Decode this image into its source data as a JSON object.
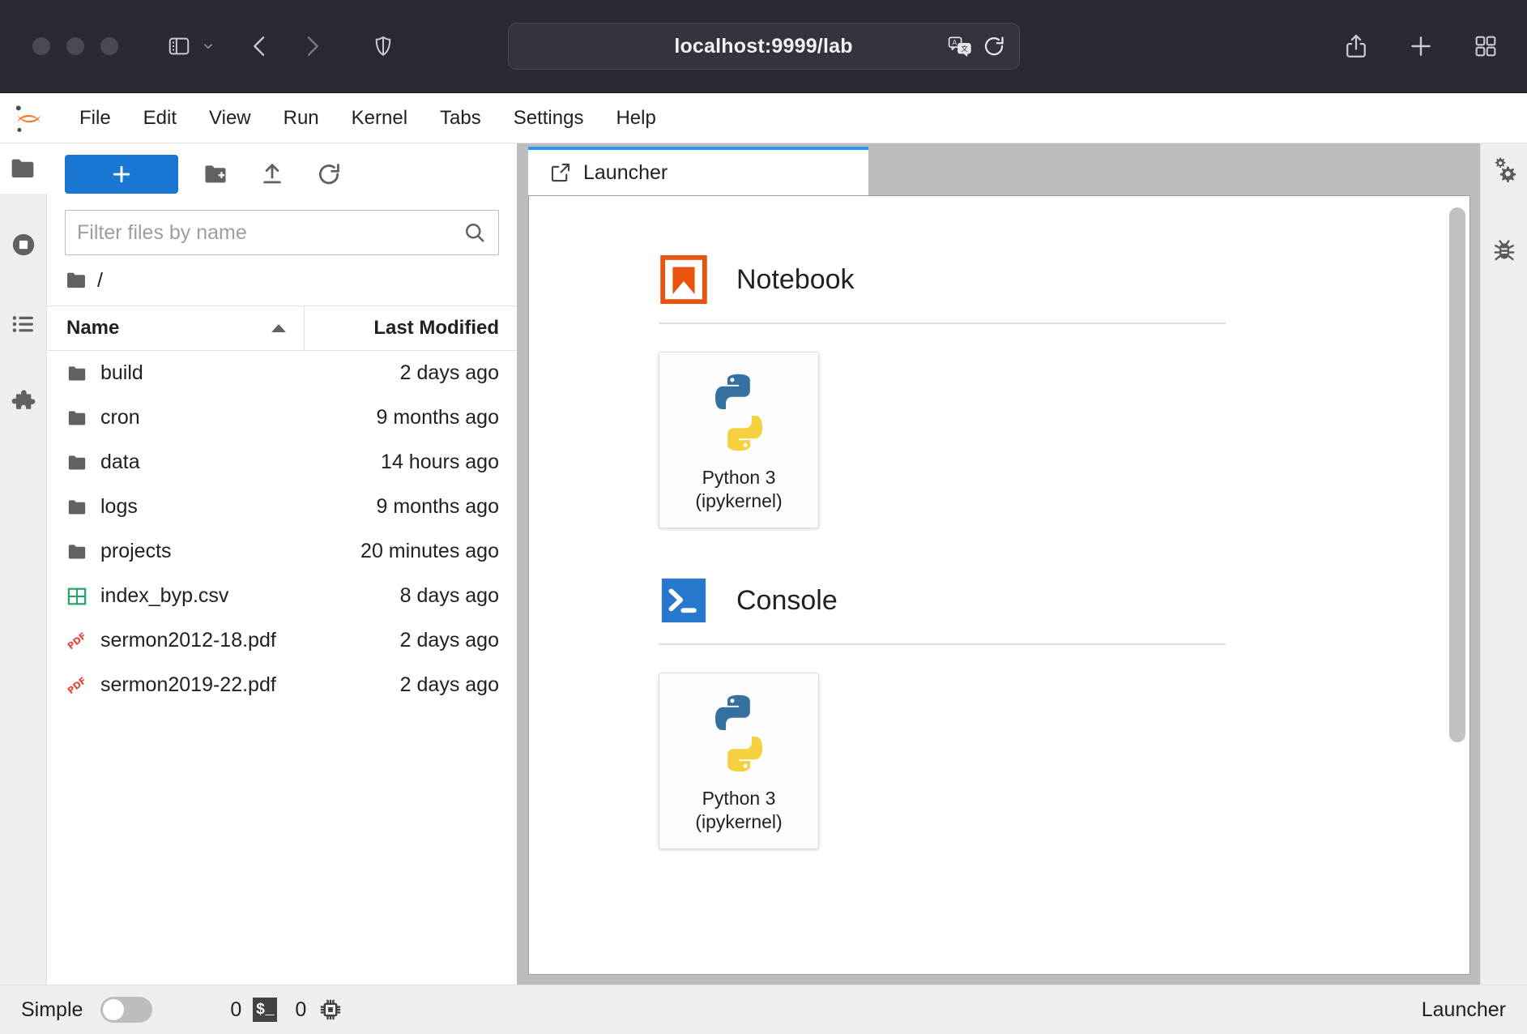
{
  "browser": {
    "url": "localhost:9999/lab",
    "icons": {
      "sidebar_toggle": "sidebar-toggle-icon",
      "sidebar_dropdown": "chevron-down-icon",
      "back": "back-arrow-icon",
      "forward": "forward-arrow-icon",
      "shield": "privacy-shield-icon",
      "translate": "translate-icon",
      "reload": "reload-icon",
      "share": "share-icon",
      "new_tab": "plus-icon",
      "tab_overview": "tab-overview-icon"
    }
  },
  "menubar": {
    "logo": "jupyter-logo",
    "items": [
      {
        "label": "File"
      },
      {
        "label": "Edit"
      },
      {
        "label": "View"
      },
      {
        "label": "Run"
      },
      {
        "label": "Kernel"
      },
      {
        "label": "Tabs"
      },
      {
        "label": "Settings"
      },
      {
        "label": "Help"
      }
    ]
  },
  "left_sidebar": {
    "items": [
      {
        "name": "file-browser",
        "icon": "folder-icon",
        "active": true
      },
      {
        "name": "running-sessions",
        "icon": "stop-circle-icon",
        "active": false
      },
      {
        "name": "commands",
        "icon": "list-icon",
        "active": false
      },
      {
        "name": "extensions",
        "icon": "puzzle-piece-icon",
        "active": false
      }
    ]
  },
  "right_sidebar": {
    "items": [
      {
        "name": "property-inspector",
        "icon": "gears-icon"
      },
      {
        "name": "debugger",
        "icon": "bug-icon"
      }
    ]
  },
  "file_browser": {
    "toolbar": {
      "new_launcher_label": "+",
      "new_folder_icon": "new-folder-icon",
      "upload_icon": "upload-icon",
      "refresh_icon": "refresh-icon"
    },
    "filter": {
      "placeholder": "Filter files by name",
      "value": "",
      "search_icon": "search-icon"
    },
    "breadcrumb": {
      "root_icon": "folder-icon",
      "path": "/"
    },
    "columns": {
      "name": "Name",
      "last_modified": "Last Modified",
      "sort": "ascending"
    },
    "rows": [
      {
        "name": "build",
        "icon": "folder-icon",
        "modified": "2 days ago"
      },
      {
        "name": "cron",
        "icon": "folder-icon",
        "modified": "9 months ago"
      },
      {
        "name": "data",
        "icon": "folder-icon",
        "modified": "14 hours ago"
      },
      {
        "name": "logs",
        "icon": "folder-icon",
        "modified": "9 months ago"
      },
      {
        "name": "projects",
        "icon": "folder-icon",
        "modified": "20 minutes ago"
      },
      {
        "name": "index_byp.csv",
        "icon": "csv-icon",
        "modified": "8 days ago"
      },
      {
        "name": "sermon2012-18.pdf",
        "icon": "pdf-icon",
        "modified": "2 days ago"
      },
      {
        "name": "sermon2019-22.pdf",
        "icon": "pdf-icon",
        "modified": "2 days ago"
      }
    ]
  },
  "dock": {
    "tab": {
      "label": "Launcher",
      "icon": "launcher-icon",
      "active": true
    }
  },
  "launcher": {
    "sections": [
      {
        "title": "Notebook",
        "icon": "notebook-icon",
        "cards": [
          {
            "line1": "Python 3",
            "line2": "(ipykernel)",
            "icon": "python-logo"
          }
        ]
      },
      {
        "title": "Console",
        "icon": "console-icon",
        "cards": [
          {
            "line1": "Python 3",
            "line2": "(ipykernel)",
            "icon": "python-logo"
          }
        ]
      }
    ]
  },
  "status_bar": {
    "mode_label": "Simple",
    "mode_enabled": false,
    "terminal_count": "0",
    "terminal_icon": "terminal-icon",
    "kernel_count": "0",
    "kernel_icon": "chip-icon",
    "context": "Launcher"
  },
  "colors": {
    "accent_blue": "#1976d2",
    "tab_active_blue": "#2196f3",
    "notebook_orange": "#e8530e",
    "console_blue": "#2878cf",
    "csv_green": "#21a366",
    "pdf_red": "#e8453c",
    "chrome_bg": "#2a2a33"
  }
}
